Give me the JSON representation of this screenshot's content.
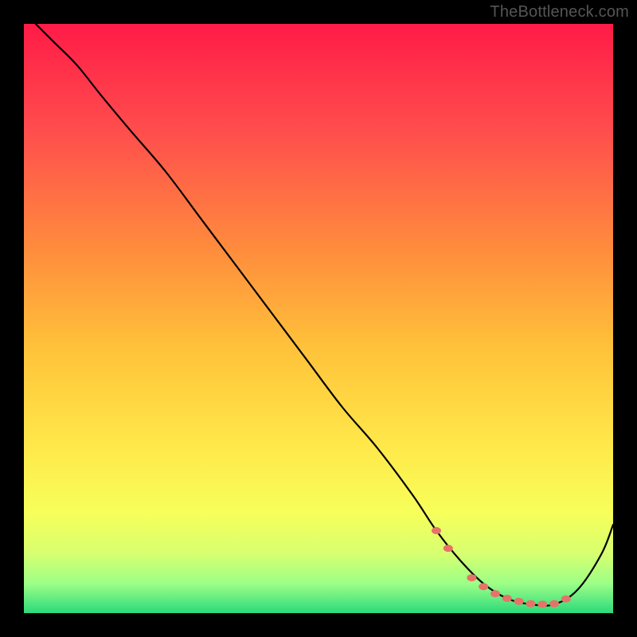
{
  "watermark": "TheBottleneck.com",
  "chart_data": {
    "type": "line",
    "title": "",
    "xlabel": "",
    "ylabel": "",
    "xlim": [
      0,
      100
    ],
    "ylim": [
      0,
      100
    ],
    "grid": false,
    "legend": false,
    "gradient_stops": [
      {
        "offset": 0,
        "color": "#ff1b47"
      },
      {
        "offset": 18,
        "color": "#ff4d4d"
      },
      {
        "offset": 38,
        "color": "#ff8b3d"
      },
      {
        "offset": 55,
        "color": "#ffc23a"
      },
      {
        "offset": 72,
        "color": "#ffe94a"
      },
      {
        "offset": 83,
        "color": "#f7ff5a"
      },
      {
        "offset": 90,
        "color": "#d6ff70"
      },
      {
        "offset": 95,
        "color": "#9cff86"
      },
      {
        "offset": 100,
        "color": "#2bd97c"
      }
    ],
    "series": [
      {
        "name": "bottleneck-curve",
        "x": [
          2,
          5,
          9,
          13,
          18,
          24,
          30,
          36,
          42,
          48,
          54,
          60,
          66,
          70,
          74,
          78,
          82,
          86,
          90,
          94,
          98,
          100
        ],
        "y": [
          100,
          97,
          93,
          88,
          82,
          75,
          67,
          59,
          51,
          43,
          35,
          28,
          20,
          14,
          9,
          5,
          2.5,
          1.5,
          1.5,
          4,
          10,
          15
        ]
      }
    ],
    "markers": {
      "name": "highlight-dots",
      "x": [
        70,
        72,
        76,
        78,
        80,
        82,
        84,
        86,
        88,
        90,
        92
      ],
      "y": [
        14,
        11,
        6,
        4.5,
        3.3,
        2.5,
        2.0,
        1.6,
        1.5,
        1.6,
        2.4
      ]
    }
  }
}
